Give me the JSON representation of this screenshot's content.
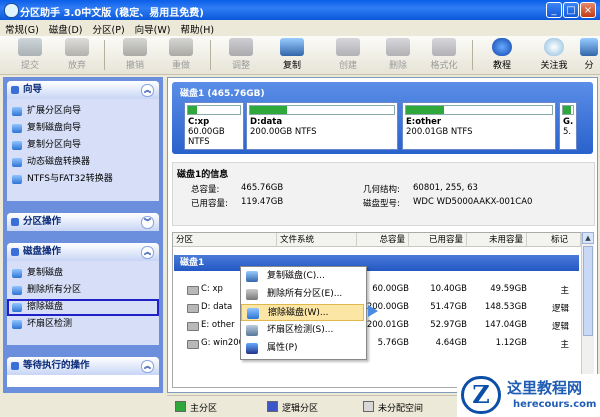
{
  "window": {
    "title": "分区助手 3.0中文版 (稳定、易用且免费)"
  },
  "menu": [
    "常规(G)",
    "磁盘(D)",
    "分区(P)",
    "向导(W)",
    "帮助(H)"
  ],
  "toolbar": [
    {
      "label": "提交",
      "icon": "checkmark-icon",
      "enabled": false
    },
    {
      "label": "放弃",
      "icon": "x-icon",
      "enabled": false
    },
    {
      "label": "撤销",
      "icon": "undo-icon",
      "enabled": false
    },
    {
      "label": "重做",
      "icon": "redo-icon",
      "enabled": false
    },
    {
      "label": "调整",
      "icon": "resize-icon",
      "enabled": false
    },
    {
      "label": "复制",
      "icon": "copy-icon",
      "enabled": true
    },
    {
      "label": "创建",
      "icon": "create-icon",
      "enabled": false
    },
    {
      "label": "删除",
      "icon": "delete-icon",
      "enabled": false
    },
    {
      "label": "格式化",
      "icon": "format-icon",
      "enabled": false
    },
    {
      "label": "教程",
      "icon": "help-icon",
      "enabled": true
    },
    {
      "label": "关注我",
      "icon": "follow-icon",
      "enabled": true
    }
  ],
  "toolbar_extra": {
    "cut_label": "分"
  },
  "sidebar": {
    "wizard": {
      "title": "向导",
      "items": [
        "扩展分区向导",
        "复制磁盘向导",
        "复制分区向导",
        "动态磁盘转换器",
        "NTFS与FAT32转换器"
      ]
    },
    "partition_ops": {
      "title": "分区操作"
    },
    "disk_ops": {
      "title": "磁盘操作",
      "items": [
        "复制磁盘",
        "删除所有分区",
        "擦除磁盘",
        "坏扇区检测"
      ],
      "selected": "擦除磁盘"
    },
    "pending": {
      "title": "等待执行的操作"
    }
  },
  "disk_map": {
    "title": "磁盘1 (465.76GB)",
    "partitions": [
      {
        "name": "C:xp",
        "size": "60.00GB NTFS",
        "used": 0.17
      },
      {
        "name": "D:data",
        "size": "200.00GB NTFS",
        "used": 0.26
      },
      {
        "name": "E:other",
        "size": "200.01GB NTFS",
        "used": 0.26
      },
      {
        "name": "G.",
        "size": "5.",
        "used": 0.8
      }
    ]
  },
  "disk_info": {
    "title": "磁盘1的信息",
    "total_label": "总容量:",
    "total": "465.76GB",
    "used_label": "已用容量:",
    "used": "119.47GB",
    "geometry_label": "几何结构:",
    "geometry": "60801, 255, 63",
    "model_label": "磁盘型号:",
    "model": "WDC WD5000AAKX-001CA0"
  },
  "table": {
    "headers": [
      "分区",
      "文件系统",
      "总容量",
      "已用容量",
      "未用容量",
      "标记"
    ],
    "disk_row": "磁盘1",
    "rows": [
      {
        "partition": "C:  xp",
        "fs": "",
        "total": "60.00GB",
        "used": "10.40GB",
        "free": "49.59GB",
        "flag": "主"
      },
      {
        "partition": "D:  data",
        "fs": "",
        "total": "200.00GB",
        "used": "51.47GB",
        "free": "148.53GB",
        "flag": "逻辑"
      },
      {
        "partition": "E:  other",
        "fs": "",
        "total": "200.01GB",
        "used": "52.97GB",
        "free": "147.04GB",
        "flag": "逻辑"
      },
      {
        "partition": "G:  win200",
        "fs": "",
        "total": "5.76GB",
        "used": "4.64GB",
        "free": "1.12GB",
        "flag": "主"
      }
    ]
  },
  "context_menu": {
    "items": [
      "复制磁盘(C)...",
      "删除所有分区(E)...",
      "擦除磁盘(W)...",
      "坏扇区检测(S)...",
      "属性(P)"
    ],
    "highlighted": "擦除磁盘(W)..."
  },
  "legend": [
    "主分区",
    "逻辑分区",
    "未分配空间"
  ],
  "watermark": {
    "logo": "Z",
    "line1": "这里教程网",
    "line2": "herecours.com"
  },
  "colors": {
    "primary": "#2ea83a",
    "logical": "#3a56c8",
    "unallocated": "#d8d8d8",
    "title_bar": "#0a5ee8",
    "disk_bar": "#2a62cc"
  }
}
